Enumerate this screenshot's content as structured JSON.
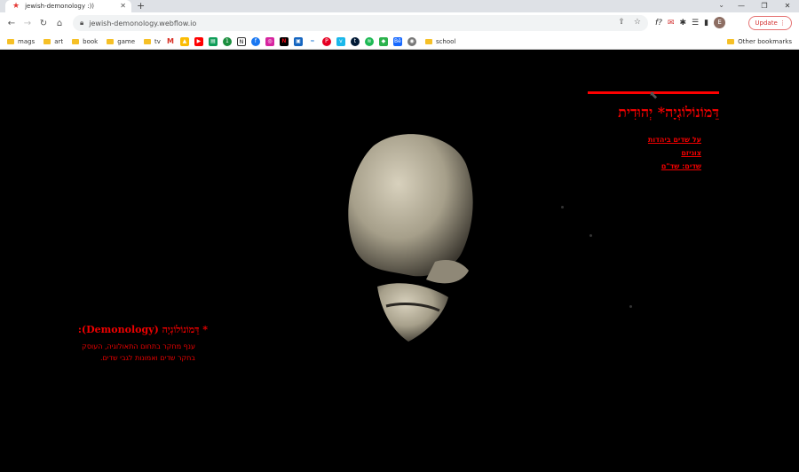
{
  "browser": {
    "tab_title": "jewish-demonology :))",
    "url": "jewish-demonology.webflow.io",
    "update_label": "Update",
    "avatar_initial": "E",
    "ext_label": "f?",
    "bookmarks": [
      {
        "type": "folder",
        "label": "mags"
      },
      {
        "type": "folder",
        "label": "art"
      },
      {
        "type": "folder",
        "label": "book"
      },
      {
        "type": "folder",
        "label": "game"
      },
      {
        "type": "folder",
        "label": "tv"
      }
    ],
    "school_label": "school",
    "other_bookmarks": "Other bookmarks"
  },
  "site": {
    "title": "דֵּמוֹנוֹלוֹגְיָה* יְהוּדִית",
    "nav": [
      "על שדים ביהדות",
      "צוגיזם",
      "שדים: שד\"ם"
    ],
    "definition_heading": "* דֵּמוֹנוֹלוֹגְיָה (Demonology):",
    "definition_body": "ענף מחקר בתחום התאולוגיה, העוסק בחקר שדים ואמונות לגבי שדים."
  },
  "colors": {
    "accent": "#ff0000",
    "background": "#000000"
  }
}
